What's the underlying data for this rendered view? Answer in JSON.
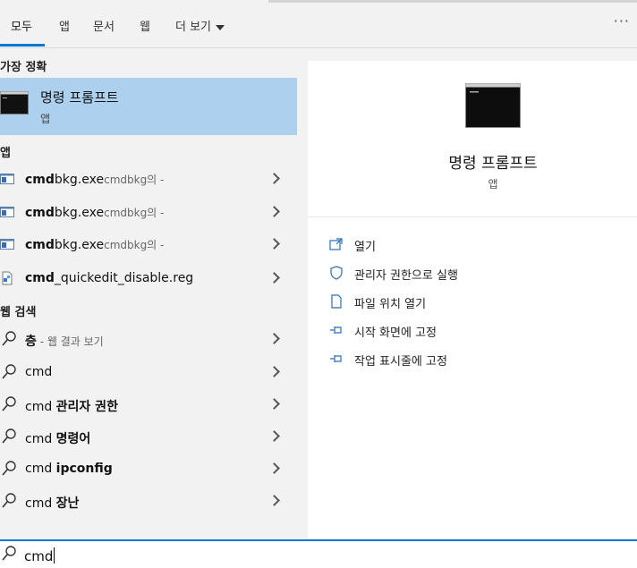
{
  "tabs": [
    "모두",
    "앱",
    "문서",
    "웹"
  ],
  "more_label": "더 보기",
  "more_options": "···",
  "best_match": {
    "heading": "가장 정확",
    "title": "명령 프롬프트",
    "subtitle": "앱"
  },
  "apps": {
    "heading": "앱",
    "items": [
      {
        "bold": "cmd",
        "rest": "bkg.exe",
        "small": "cmdbkg의 -",
        "icon": "app-window-icon"
      },
      {
        "bold": "cmd",
        "rest": "bkg.exe",
        "small": "cmdbkg의 -",
        "icon": "app-window-icon"
      },
      {
        "bold": "cmd",
        "rest": "bkg.exe",
        "small": "cmdbkg의 -",
        "icon": "app-window-icon"
      },
      {
        "bold": "cmd",
        "rest": "_quickedit_disable.reg",
        "small": "",
        "icon": "registry-file-icon"
      }
    ]
  },
  "web": {
    "heading": "웹 검색",
    "items": [
      {
        "plain": "",
        "bold": "층",
        "small": " - 웹 결과 보기"
      },
      {
        "plain": "cmd",
        "bold": "",
        "small": ""
      },
      {
        "plain": "cmd ",
        "bold": "관리자 권한",
        "small": ""
      },
      {
        "plain": "cmd ",
        "bold": "명령어",
        "small": ""
      },
      {
        "plain": "cmd ",
        "bold": "ipconfig",
        "small": ""
      },
      {
        "plain": "cmd ",
        "bold": "장난",
        "small": ""
      }
    ]
  },
  "detail": {
    "title": "명령 프롬프트",
    "subtitle": "앱",
    "actions": [
      {
        "label": "열기",
        "icon": "open-icon"
      },
      {
        "label": "관리자 권한으로 실행",
        "icon": "shield-icon"
      },
      {
        "label": "파일 위치 열기",
        "icon": "file-location-icon"
      },
      {
        "label": "시작 화면에 고정",
        "icon": "pin-icon"
      },
      {
        "label": "작업 표시줄에 고정",
        "icon": "pin-icon"
      }
    ]
  },
  "search": {
    "value": "cmd"
  },
  "colors": {
    "accent": "#0078d4",
    "selected": "#acd0ee",
    "panel": "#ffffff",
    "background": "#f2f2f2"
  }
}
